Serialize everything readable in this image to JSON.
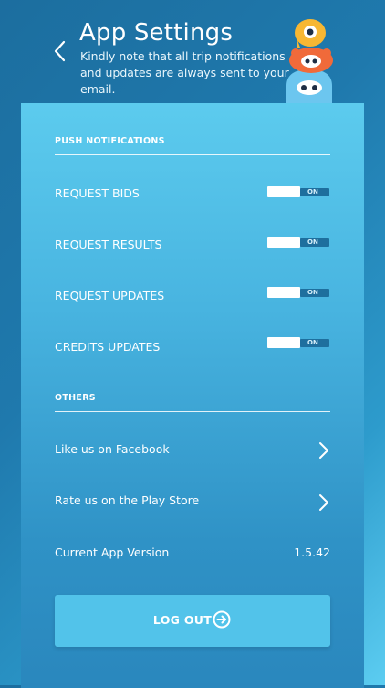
{
  "header": {
    "title": "App Settings",
    "subtitle": "Kindly note that all trip notifications and updates are always sent to your email."
  },
  "push_notifications": {
    "label": "PUSH NOTIFICATIONS",
    "items": [
      {
        "label": "REQUEST BIDS",
        "toggle": "ON"
      },
      {
        "label": "REQUEST RESULTS",
        "toggle": "ON"
      },
      {
        "label": "REQUEST UPDATES",
        "toggle": "ON"
      },
      {
        "label": "CREDITS UPDATES",
        "toggle": "ON"
      }
    ]
  },
  "others": {
    "label": "OTHERS",
    "items": [
      {
        "label": "Like us on Facebook",
        "icon": "chevron-right-icon"
      },
      {
        "label": "Rate us on the Play Store",
        "icon": "chevron-right-icon"
      }
    ],
    "version_label": "Current App Version",
    "version_value": "1.5.42"
  },
  "logout": {
    "label": "LOG OUT",
    "icon": "arrow-right-circle-icon"
  },
  "colors": {
    "panel_top": "#5ccbee",
    "background": "#1f79ad",
    "button": "#52c3ea",
    "toggle_track": "#1e6f9e"
  }
}
